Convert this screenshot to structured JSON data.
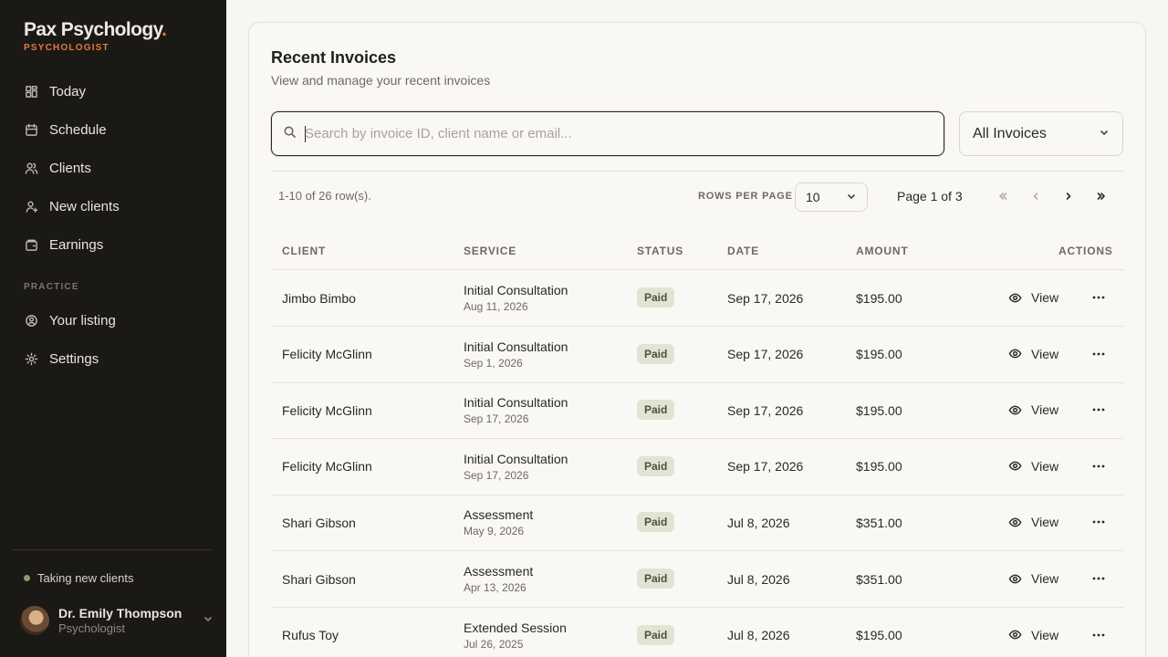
{
  "sidebar": {
    "brand": "Pax Psychology",
    "brand_dot": ".",
    "role": "PSYCHOLOGIST",
    "nav": [
      {
        "label": "Today",
        "icon": "dashboard-icon"
      },
      {
        "label": "Schedule",
        "icon": "calendar-icon"
      },
      {
        "label": "Clients",
        "icon": "users-icon"
      },
      {
        "label": "New clients",
        "icon": "user-plus-icon"
      },
      {
        "label": "Earnings",
        "icon": "wallet-icon"
      }
    ],
    "practice_label": "PRACTICE",
    "practice_nav": [
      {
        "label": "Your listing",
        "icon": "user-circle-icon"
      },
      {
        "label": "Settings",
        "icon": "gear-icon"
      }
    ],
    "availability": "Taking new clients",
    "user": {
      "name": "Dr. Emily Thompson",
      "role": "Psychologist"
    }
  },
  "main": {
    "title": "Recent Invoices",
    "subtitle": "View and manage your recent invoices",
    "search": {
      "placeholder": "Search by invoice ID, client name or email...",
      "value": ""
    },
    "filter": {
      "selected": "All Invoices"
    },
    "pagination": {
      "row_count": "1-10 of 26 row(s).",
      "rows_per_page_label": "ROWS PER PAGE",
      "rows_per_page": "10",
      "page_info": "Page 1 of 3"
    },
    "table": {
      "headers": {
        "client": "CLIENT",
        "service": "SERVICE",
        "status": "STATUS",
        "date": "DATE",
        "amount": "AMOUNT",
        "actions": "ACTIONS"
      },
      "view_label": "View",
      "rows": [
        {
          "client": "Jimbo Bimbo",
          "service": "Initial Consultation",
          "service_date": "Aug 11, 2026",
          "status": "Paid",
          "date": "Sep 17, 2026",
          "amount": "$195.00"
        },
        {
          "client": "Felicity McGlinn",
          "service": "Initial Consultation",
          "service_date": "Sep 1, 2026",
          "status": "Paid",
          "date": "Sep 17, 2026",
          "amount": "$195.00"
        },
        {
          "client": "Felicity McGlinn",
          "service": "Initial Consultation",
          "service_date": "Sep 17, 2026",
          "status": "Paid",
          "date": "Sep 17, 2026",
          "amount": "$195.00"
        },
        {
          "client": "Felicity McGlinn",
          "service": "Initial Consultation",
          "service_date": "Sep 17, 2026",
          "status": "Paid",
          "date": "Sep 17, 2026",
          "amount": "$195.00"
        },
        {
          "client": "Shari Gibson",
          "service": "Assessment",
          "service_date": "May 9, 2026",
          "status": "Paid",
          "date": "Jul 8, 2026",
          "amount": "$351.00"
        },
        {
          "client": "Shari Gibson",
          "service": "Assessment",
          "service_date": "Apr 13, 2026",
          "status": "Paid",
          "date": "Jul 8, 2026",
          "amount": "$351.00"
        },
        {
          "client": "Rufus Toy",
          "service": "Extended Session",
          "service_date": "Jul 26, 2025",
          "status": "Paid",
          "date": "Jul 8, 2026",
          "amount": "$195.00"
        }
      ]
    }
  },
  "colors": {
    "accent": "#e07a3c",
    "sidebar_bg": "#1b1915",
    "badge_bg": "#e2e3d2"
  }
}
